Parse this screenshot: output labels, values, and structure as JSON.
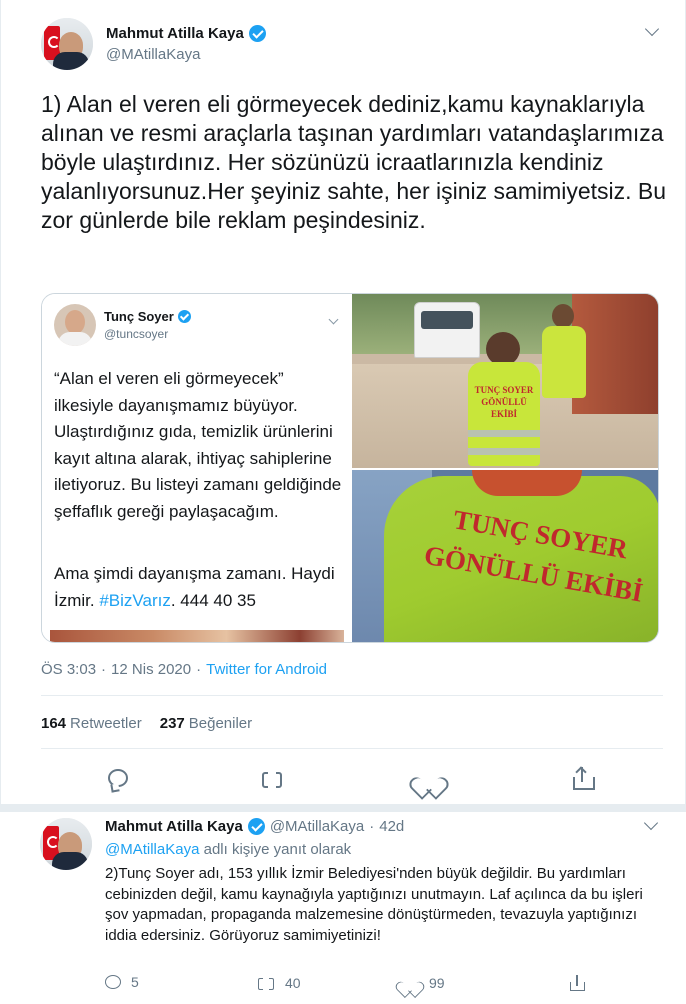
{
  "main_tweet": {
    "author_name": "Mahmut Atilla Kaya",
    "author_handle": "@MAtillaKaya",
    "text": "1) Alan el veren eli görmeyecek dediniz,kamu kaynaklarıyla alınan ve resmi araçlarla taşınan yardımları vatandaşlarımıza böyle ulaştırdınız. Her sözünüzü icraatlarınızla kendiniz yalanlıyorsunuz.Her şeyiniz sahte, her işiniz samimiyetsiz. Bu zor günlerde bile reklam peşindesiniz.",
    "quoted": {
      "author_name": "Tunç Soyer",
      "author_handle": "@tuncsoyer",
      "text": "“Alan el veren eli görmeyecek” ilkesiyle dayanışmamız büyüyor. Ulaştırdığınız gıda, temizlik ürünlerini kayıt altına alarak, ihtiyaç sahiplerine iletiyoruz. Bu listeyi zamanı geldiğinde şeffaflık gereği paylaşacağım.",
      "text2_prefix": "Ama şimdi dayanışma zamanı. Haydi İzmir.",
      "hashtag": "#BizVarız",
      "phone": "444 40 35",
      "photo_top_vest_line1": "TUNÇ SOYER",
      "photo_top_vest_line2": "GÖNÜLLÜ EKİBİ",
      "photo_bottom_vest_line1": "TUNÇ SOYER",
      "photo_bottom_vest_line2": "GÖNÜLLÜ EKİBİ"
    },
    "time": "ÖS 3:03",
    "date": "12 Nis 2020",
    "dot": "·",
    "source": "Twitter for Android",
    "retweet_count": "164",
    "retweet_label": "Retweetler",
    "like_count": "237",
    "like_label": "Beğeniler",
    "icons": [
      "reply-icon",
      "retweet-icon",
      "like-icon",
      "share-icon"
    ]
  },
  "reply_tweet": {
    "author_name": "Mahmut Atilla Kaya",
    "author_handle": "@MAtillaKaya",
    "dot": "·",
    "age": "42d",
    "reply_to_handle": "@MAtillaKaya",
    "reply_to_suffix": "adlı kişiye yanıt olarak",
    "text": "2)Tunç Soyer adı, 153 yıllık İzmir Belediyesi'nden büyük değildir. Bu yardımları cebinizden değil, kamu kaynağıyla yaptığınızı unutmayın. Laf açılınca da bu işleri şov yapmadan, propaganda malzemesine dönüştürmeden, tevazuyla yaptığınızı iddia edersiniz. Görüyoruz samimiyetinizi!",
    "reply_count": "5",
    "retweet_count": "40",
    "like_count": "99"
  },
  "colors": {
    "accent": "#1da1f2",
    "secondary_text": "#657786",
    "border": "#e6ecf0",
    "vest": "#c8e63a",
    "vest_text": "#c0282d"
  }
}
